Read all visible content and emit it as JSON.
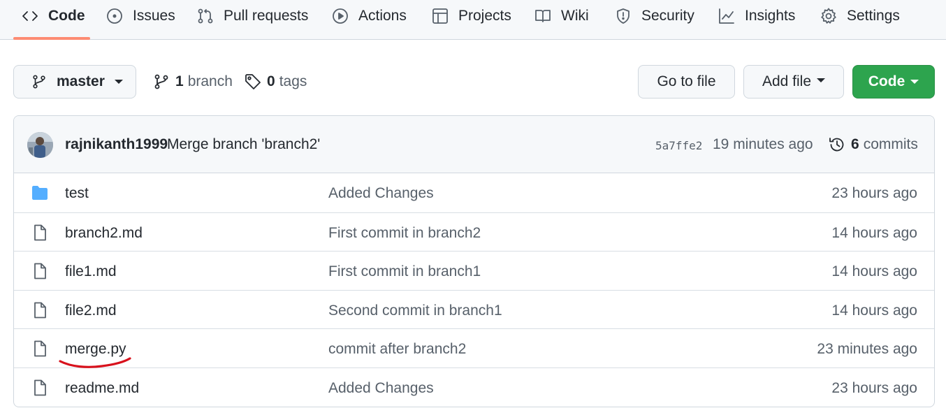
{
  "nav": {
    "tabs": [
      {
        "label": "Code",
        "icon": "code-icon",
        "active": true
      },
      {
        "label": "Issues",
        "icon": "issue-circle-icon"
      },
      {
        "label": "Pull requests",
        "icon": "pull-request-icon"
      },
      {
        "label": "Actions",
        "icon": "play-icon"
      },
      {
        "label": "Projects",
        "icon": "table-icon"
      },
      {
        "label": "Wiki",
        "icon": "book-icon"
      },
      {
        "label": "Security",
        "icon": "shield-icon"
      },
      {
        "label": "Insights",
        "icon": "graph-icon"
      },
      {
        "label": "Settings",
        "icon": "gear-icon"
      }
    ],
    "active_underline_color": "#fd8c73"
  },
  "branch_bar": {
    "branch_select": "master",
    "branch_count": "1",
    "branch_word": "branch",
    "tag_count": "0",
    "tag_word": "tags",
    "go_to_file": "Go to file",
    "add_file": "Add file",
    "code_button": "Code",
    "code_button_color": "#2da44e"
  },
  "latest_commit": {
    "author": "rajnikanth1999",
    "message": "Merge branch 'branch2'",
    "sha": "5a7ffe2",
    "time": "19 minutes ago",
    "commit_count": "6",
    "commit_word": "commits"
  },
  "files": [
    {
      "type": "folder",
      "name": "test",
      "message": "Added Changes",
      "time": "23 hours ago"
    },
    {
      "type": "file",
      "name": "branch2.md",
      "message": "First commit in branch2",
      "time": "14 hours ago"
    },
    {
      "type": "file",
      "name": "file1.md",
      "message": "First commit in branch1",
      "time": "14 hours ago"
    },
    {
      "type": "file",
      "name": "file2.md",
      "message": "Second commit in branch1",
      "time": "14 hours ago"
    },
    {
      "type": "file",
      "name": "merge.py",
      "message": "commit after branch2",
      "time": "23 minutes ago"
    },
    {
      "type": "file",
      "name": "readme.md",
      "message": "Added Changes",
      "time": "23 hours ago"
    }
  ],
  "colors": {
    "folder": "#54aeff",
    "annotation": "#d8111c"
  }
}
